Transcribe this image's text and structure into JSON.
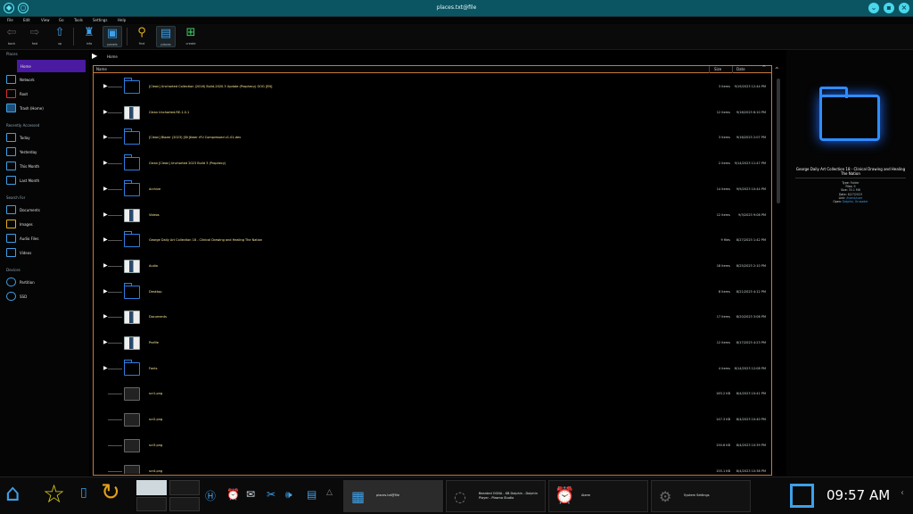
{
  "titlebar": {
    "title": "places.txt@file"
  },
  "menu": [
    "File",
    "Edit",
    "View",
    "Go",
    "Tools",
    "Settings",
    "Help"
  ],
  "toolbar": {
    "back": "back",
    "forward": "fwd",
    "up": "up",
    "info": "info",
    "panels": "panels",
    "find": "find",
    "places": "places",
    "create": "create"
  },
  "breadcrumb": {
    "location": "Home"
  },
  "sidebar": {
    "sections": [
      {
        "title": "Places",
        "items": [
          {
            "label": "Home",
            "active": true
          },
          {
            "label": "Network"
          },
          {
            "label": "Root"
          },
          {
            "label": "Trash (Home)"
          }
        ]
      },
      {
        "title": "Recently Accessed",
        "items": [
          {
            "label": "Today"
          },
          {
            "label": "Yesterday"
          },
          {
            "label": "This Month"
          },
          {
            "label": "Last Month"
          }
        ]
      },
      {
        "title": "Search For",
        "items": [
          {
            "label": "Documents"
          },
          {
            "label": "Images"
          },
          {
            "label": "Audio Files"
          },
          {
            "label": "Videos"
          }
        ]
      },
      {
        "title": "Devices",
        "items": [
          {
            "label": "Partition"
          },
          {
            "label": "SSD"
          }
        ]
      }
    ]
  },
  "files": {
    "columns": {
      "name": "Name",
      "size": "Size",
      "date": "Date"
    },
    "rows": [
      {
        "name": "[Clean] Uncharted Collection (2016) Build-2020.3 Update (Prophecy) GOG [EN]",
        "size": "3 items",
        "date": "9/19/2023 12:44 PM",
        "icon": "folder"
      },
      {
        "name": "Clean Uncharted.RE-1.0.1",
        "size": "12 items",
        "date": "9/18/2023 6:10 PM",
        "icon": "img"
      },
      {
        "name": "[Clean] Blazer (2023) [Sh]tiwer rFU Compressed v1.01-dev",
        "size": "3 items",
        "date": "9/16/2023 2:07 PM",
        "icon": "folder"
      },
      {
        "name": "Clean [Clean] Uncharted 2023 Build 3 (Prophecy)",
        "size": "2 items",
        "date": "9/14/2023 11:47 PM",
        "icon": "folder"
      },
      {
        "name": "Archive",
        "size": "14 items",
        "date": "9/9/2023 10:44 PM",
        "icon": "folder"
      },
      {
        "name": "Videos",
        "size": "12 items",
        "date": "9/3/2023 9:08 PM",
        "icon": "img"
      },
      {
        "name": "George Daily Art Collection 18 - Clinical Drawing and Healing The Nation",
        "size": "9 files",
        "date": "8/27/2023 1:42 PM",
        "icon": "folder"
      },
      {
        "name": "Audio",
        "size": "18 items",
        "date": "8/25/2023 2:10 PM",
        "icon": "img"
      },
      {
        "name": "Desktop",
        "size": "8 items",
        "date": "8/21/2023 4:12 PM",
        "icon": "folder"
      },
      {
        "name": "Documents",
        "size": "17 items",
        "date": "8/20/2023 3:06 PM",
        "icon": "img"
      },
      {
        "name": "Profile",
        "size": "12 items",
        "date": "8/17/2023 4:23 PM",
        "icon": "img"
      },
      {
        "name": "Fonts",
        "size": "4 items",
        "date": "8/14/2023 12:08 PM",
        "icon": "folder"
      },
      {
        "name": "scr1.png",
        "size": "163.2 KB",
        "date": "8/4/2023 10:41 PM",
        "icon": "pic"
      },
      {
        "name": "scr2.png",
        "size": "147.3 KB",
        "date": "8/4/2023 10:40 PM",
        "icon": "pic"
      },
      {
        "name": "scr3.png",
        "size": "150.6 KB",
        "date": "8/4/2023 10:39 PM",
        "icon": "pic"
      },
      {
        "name": "scr4.png",
        "size": "155.1 KB",
        "date": "8/4/2023 10:38 PM",
        "icon": "pic"
      }
    ]
  },
  "preview": {
    "name": "George Daily Art Collection 18 - Clinical Drawing and Healing The Nation",
    "meta": [
      {
        "k": "Type:",
        "v": "Folder"
      },
      {
        "k": "Files:",
        "v": "9"
      },
      {
        "k": "Size:",
        "v": "33.1 MB"
      },
      {
        "k": "Date:",
        "v": "8/27/2023"
      },
      {
        "k": "Link:",
        "v": "/home/user"
      },
      {
        "k": "Open:",
        "v": "Dolphin, Krusader"
      }
    ]
  },
  "taskbar": {
    "tasks": [
      {
        "label": "places.txt@file",
        "selected": true
      },
      {
        "label": "Bearded OGNA - KB Dolphin - Dolphin Player - Plasma Studio"
      },
      {
        "label": "Alarm"
      },
      {
        "label": "System Settings"
      }
    ],
    "clock": "09:57 AM"
  }
}
